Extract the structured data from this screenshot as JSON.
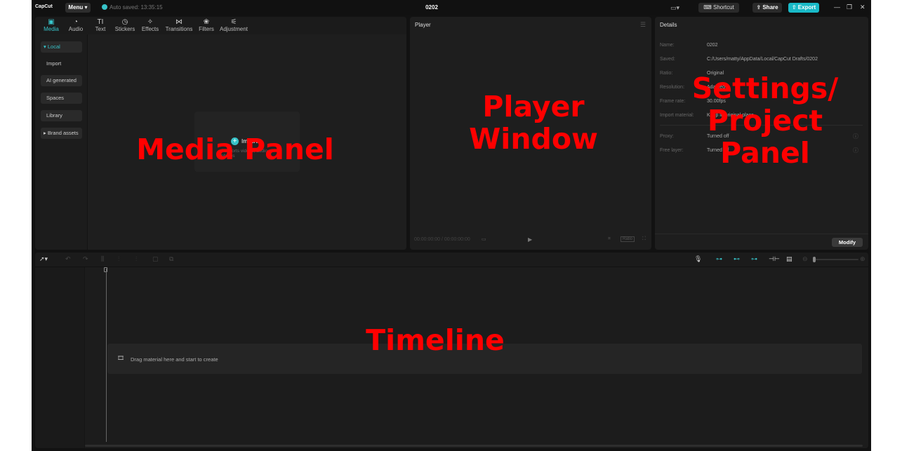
{
  "titlebar": {
    "logo": "CapCut",
    "menu_label": "Menu",
    "autosave": "Auto saved: 13:35:15",
    "project_title": "0202",
    "shortcut": "Shortcut",
    "share": "Share",
    "export": "Export"
  },
  "media_panel": {
    "tabs": [
      {
        "label": "Media",
        "icon": "media-icon"
      },
      {
        "label": "Audio",
        "icon": "audio-icon"
      },
      {
        "label": "Text",
        "icon": "text-icon"
      },
      {
        "label": "Stickers",
        "icon": "stickers-icon"
      },
      {
        "label": "Effects",
        "icon": "effects-icon"
      },
      {
        "label": "Transitions",
        "icon": "transitions-icon"
      },
      {
        "label": "Filters",
        "icon": "filters-icon"
      },
      {
        "label": "Adjustment",
        "icon": "adjustment-icon"
      }
    ],
    "active_tab": "Media",
    "sidebar": [
      "Local",
      "Import",
      "AI generated",
      "Spaces",
      "Library",
      "Brand assets"
    ],
    "import_label": "Import",
    "import_hint": "Supports videos, audio, photos"
  },
  "player": {
    "title": "Player",
    "timecode": "00:00:00:00 / 00:00:00:00",
    "ratio_label": "Ratio"
  },
  "details": {
    "title": "Details",
    "rows": [
      {
        "label": "Name:",
        "value": "0202"
      },
      {
        "label": "Saved:",
        "value": "C:/Users/matty/AppData/Local/CapCut Drafts/0202"
      },
      {
        "label": "Ratio:",
        "value": "Original"
      },
      {
        "label": "Resolution:",
        "value": "Adapted"
      },
      {
        "label": "Frame rate:",
        "value": "30.00fps"
      },
      {
        "label": "Import material:",
        "value": "Keep in original place"
      }
    ],
    "extra_rows": [
      {
        "label": "Proxy:",
        "value": "Turned off"
      },
      {
        "label": "Free layer:",
        "value": "Turned off"
      }
    ],
    "modify": "Modify"
  },
  "timeline": {
    "drop_text": "Drag material here and start to create"
  },
  "overlays": {
    "media": "Media Panel",
    "player": "Player\nWindow",
    "settings": "Settings/\nProject\nPanel",
    "timeline": "Timeline"
  },
  "colors": {
    "accent": "#37c3c9",
    "export_bg": "#19b9c7",
    "overlay_text": "#ff0000"
  }
}
